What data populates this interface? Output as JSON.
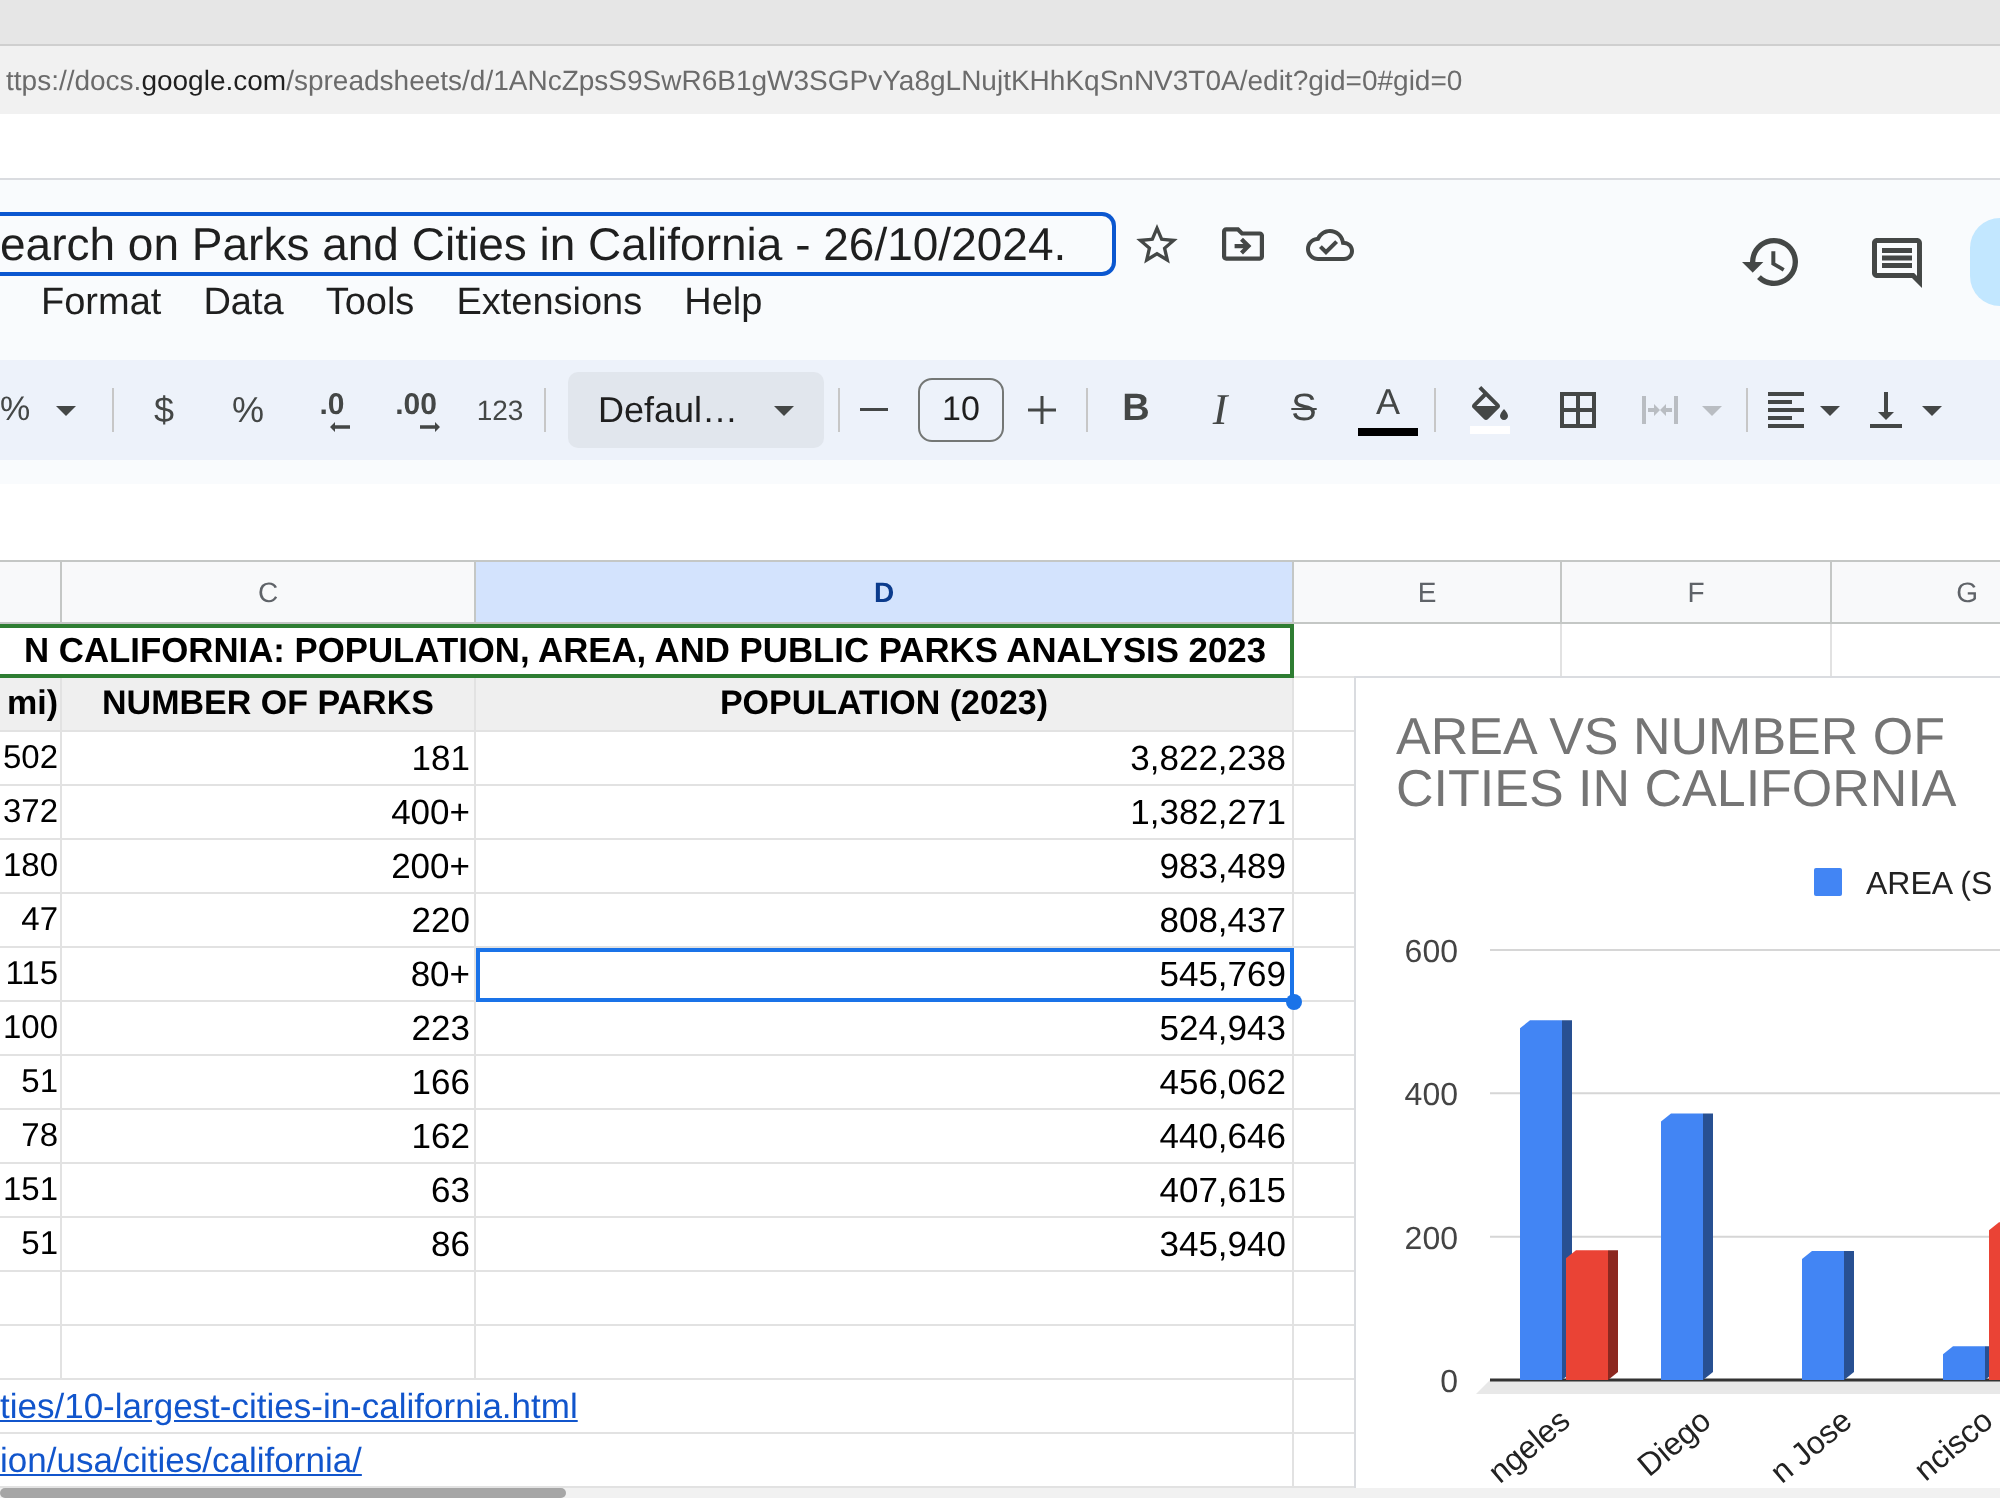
{
  "browser": {
    "url": {
      "start": "ttps://docs.",
      "domain": "google.com",
      "path": "/spreadsheets/d/1ANcZpsS9SwR6B1gW3SGPvYa8gLNujtKHhKqSnNV3T0A/edit?gid=0#gid=0"
    }
  },
  "document": {
    "title": "earch on Parks and Cities in California - 26/10/2024."
  },
  "menu": [
    "Format",
    "Data",
    "Tools",
    "Extensions",
    "Help"
  ],
  "toolbar": {
    "zoom": "%",
    "currency": "$",
    "percent": "%",
    "decrease_decimal": ".0",
    "increase_decimal": ".00",
    "more_formats": "123",
    "font": "Defaul…",
    "font_size": "10",
    "bold": "B",
    "italic": "I",
    "strikethrough": "S",
    "text_color": "A",
    "merge_cells": {
      "disabled": true
    }
  },
  "sheet": {
    "columns": [
      {
        "selected": false
      },
      {
        "label": "C",
        "selected": false
      },
      {
        "label": "D",
        "selected": true
      },
      {
        "label": "E",
        "selected": false
      },
      {
        "label": "F",
        "selected": false
      },
      {
        "label": "G",
        "selected": false
      }
    ],
    "title_row": "N CALIFORNIA: POPULATION, AREA, AND PUBLIC PARKS ANALYSIS 2023",
    "header_row": [
      "mi)",
      "NUMBER OF PARKS",
      "POPULATION (2023)"
    ],
    "rows": [
      {
        "cells": [
          {
            "text": "502",
            "selected": false
          },
          {
            "text": "181",
            "selected": false
          },
          {
            "text": "3,822,238",
            "selected": false
          }
        ]
      },
      {
        "cells": [
          {
            "text": "372",
            "selected": false
          },
          {
            "text": "400+",
            "selected": false
          },
          {
            "text": "1,382,271",
            "selected": false
          }
        ]
      },
      {
        "cells": [
          {
            "text": "180",
            "selected": false
          },
          {
            "text": "200+",
            "selected": false
          },
          {
            "text": "983,489",
            "selected": false
          }
        ]
      },
      {
        "cells": [
          {
            "text": "47",
            "selected": false
          },
          {
            "text": "220",
            "selected": false
          },
          {
            "text": "808,437",
            "selected": false
          }
        ]
      },
      {
        "cells": [
          {
            "text": "115",
            "selected": false
          },
          {
            "text": "80+",
            "selected": false
          },
          {
            "text": "545,769",
            "selected": true
          }
        ]
      },
      {
        "cells": [
          {
            "text": "100",
            "selected": false
          },
          {
            "text": "223",
            "selected": false
          },
          {
            "text": "524,943",
            "selected": false
          }
        ]
      },
      {
        "cells": [
          {
            "text": "51",
            "selected": false
          },
          {
            "text": "166",
            "selected": false
          },
          {
            "text": "456,062",
            "selected": false
          }
        ]
      },
      {
        "cells": [
          {
            "text": "78",
            "selected": false
          },
          {
            "text": "162",
            "selected": false
          },
          {
            "text": "440,646",
            "selected": false
          }
        ]
      },
      {
        "cells": [
          {
            "text": "151",
            "selected": false
          },
          {
            "text": "63",
            "selected": false
          },
          {
            "text": "407,615",
            "selected": false
          }
        ]
      },
      {
        "cells": [
          {
            "text": "51",
            "selected": false
          },
          {
            "text": "86",
            "selected": false
          },
          {
            "text": "345,940",
            "selected": false
          }
        ]
      }
    ],
    "links": [
      "ties/10-largest-cities-in-california.html",
      "ion/usa/cities/california/"
    ]
  },
  "chart": {
    "title_lines": [
      "AREA VS NUMBER OF",
      "CITIES IN CALIFORNIA"
    ],
    "chart_data": {
      "type": "bar",
      "categories": [
        "ngeles",
        "Diego",
        "n Jose",
        "ncisco"
      ],
      "series": [
        {
          "name": "AREA (S",
          "color": "#4285f4",
          "values": [
            502,
            372,
            180,
            47
          ]
        },
        {
          "color": "#ea4335",
          "values": [
            181,
            null,
            null,
            220
          ]
        }
      ],
      "ylim": [
        0,
        600
      ],
      "yticks": [
        0,
        200,
        400,
        600
      ]
    }
  }
}
